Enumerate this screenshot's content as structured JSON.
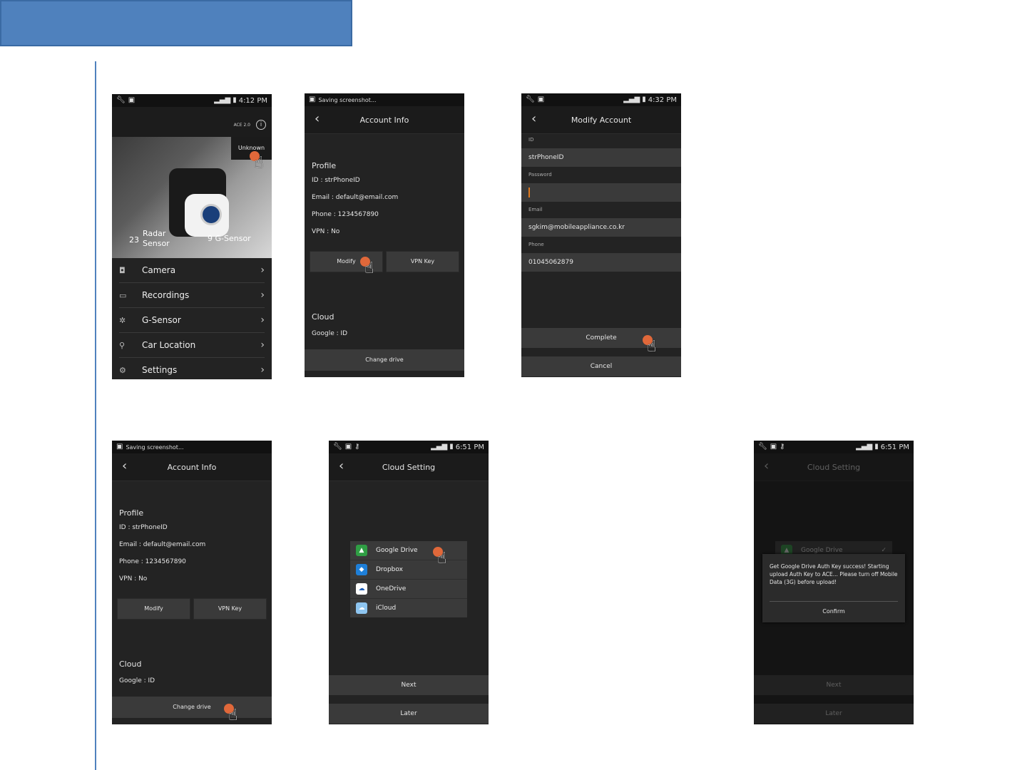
{
  "status": {
    "p1_time": "4:12 PM",
    "p2_title": "Saving screenshot...",
    "p3_time": "4:32 PM",
    "p4_title": "Saving screenshot...",
    "p5_time": "6:51 PM",
    "p6_time": "6:51 PM"
  },
  "home": {
    "version": "ACE 2.0",
    "info_glyph": "i",
    "unknown_label": "Unknown",
    "radar_count": "23",
    "radar_label": "Radar Sensor",
    "gsensor_label": "9  G-Sensor",
    "menu": [
      {
        "icon": "camera-icon",
        "glyph": "◘",
        "label": "Camera"
      },
      {
        "icon": "recordings-icon",
        "glyph": "▭",
        "label": "Recordings"
      },
      {
        "icon": "gsensor-icon",
        "glyph": "✲",
        "label": "G-Sensor"
      },
      {
        "icon": "location-pin-icon",
        "glyph": "⚲",
        "label": "Car Location"
      },
      {
        "icon": "gear-icon",
        "glyph": "⚙",
        "label": "Settings"
      }
    ]
  },
  "account_info": {
    "title": "Account Info",
    "profile": "Profile",
    "id": "ID : strPhoneID",
    "email": "Email : default@email.com",
    "phone": "Phone : 1234567890",
    "vpn": "VPN : No",
    "modify": "Modify",
    "vpn_key": "VPN Key",
    "cloud": "Cloud",
    "google": "Google : ID",
    "change_drive": "Change drive"
  },
  "modify_account": {
    "title": "Modify Account",
    "id_label": "ID",
    "id_value": "strPhoneID",
    "password_label": "Password",
    "email_label": "Email",
    "email_value": "sgkim@mobileappliance.co.kr",
    "phone_label": "Phone",
    "phone_value": "01045062879",
    "complete": "Complete",
    "cancel": "Cancel"
  },
  "cloud_setting": {
    "title": "Cloud Setting",
    "options": [
      {
        "label": "Google Drive",
        "color": "#2f9e44"
      },
      {
        "label": "Dropbox",
        "color": "#1e7fd8"
      },
      {
        "label": "OneDrive",
        "color": "#ffffff"
      },
      {
        "label": "iCloud",
        "color": "#8ec5f0"
      }
    ],
    "next": "Next",
    "later": "Later",
    "check": "✓",
    "dialog_message": "Get Google Drive Auth Key success! Starting upload Auth Key to ACE... Please turn off Mobile Data (3G) before upload!",
    "confirm": "Confirm"
  },
  "colors": {
    "accent_blue": "#4f81bd",
    "tap_indicator": "#e0683a",
    "cursor": "#e07a1f"
  }
}
